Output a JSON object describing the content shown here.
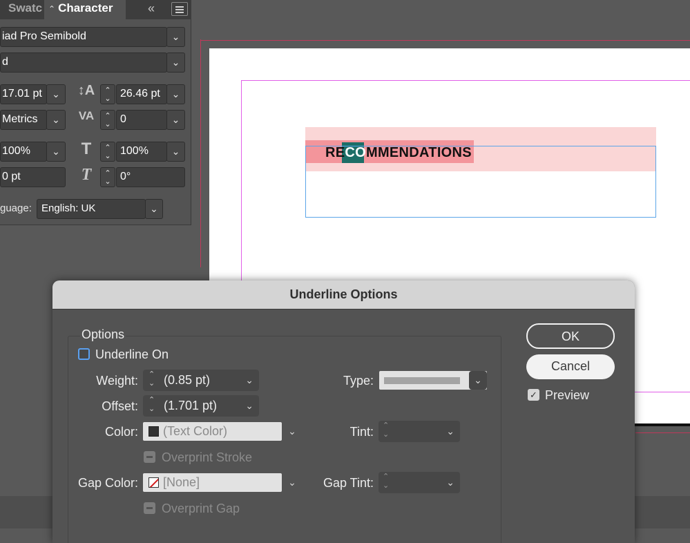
{
  "character_panel": {
    "tabs": {
      "swatches": "Swatc",
      "character": "Character"
    },
    "font_family": "iad Pro Semibold",
    "font_style": "d",
    "font_size": "17.01 pt",
    "leading": "26.46 pt",
    "kerning": "Metrics",
    "tracking": "0",
    "vertical_scale": "100%",
    "horizontal_scale": "100%",
    "baseline_shift": "0 pt",
    "skew": "0°",
    "language_label": "guage:",
    "language": "English: UK"
  },
  "document": {
    "headline_pre": "RE",
    "headline_sel": "CO",
    "headline_post": "MMENDATIONS"
  },
  "dialog": {
    "title": "Underline Options",
    "group_label": "Options",
    "underline_on_label": "Underline On",
    "weight_label": "Weight:",
    "weight_value": "(0.85 pt)",
    "offset_label": "Offset:",
    "offset_value": "(1.701 pt)",
    "type_label": "Type:",
    "color_label": "Color:",
    "color_value": "(Text Color)",
    "tint_label": "Tint:",
    "overprint_stroke_label": "Overprint Stroke",
    "gap_color_label": "Gap Color:",
    "gap_color_value": "[None]",
    "gap_tint_label": "Gap Tint:",
    "overprint_gap_label": "Overprint Gap",
    "ok_label": "OK",
    "cancel_label": "Cancel",
    "preview_label": "Preview",
    "underline_on_checked": false,
    "preview_checked": true
  },
  "colors": {
    "selection": "#1d6e67",
    "text_highlight": "#f3959b",
    "paragraph_shading": "#fad6d6",
    "margin_guide": "#e15ee8",
    "frame_edge": "#5ba5e8",
    "checkbox_accent": "#5aa0f0"
  }
}
